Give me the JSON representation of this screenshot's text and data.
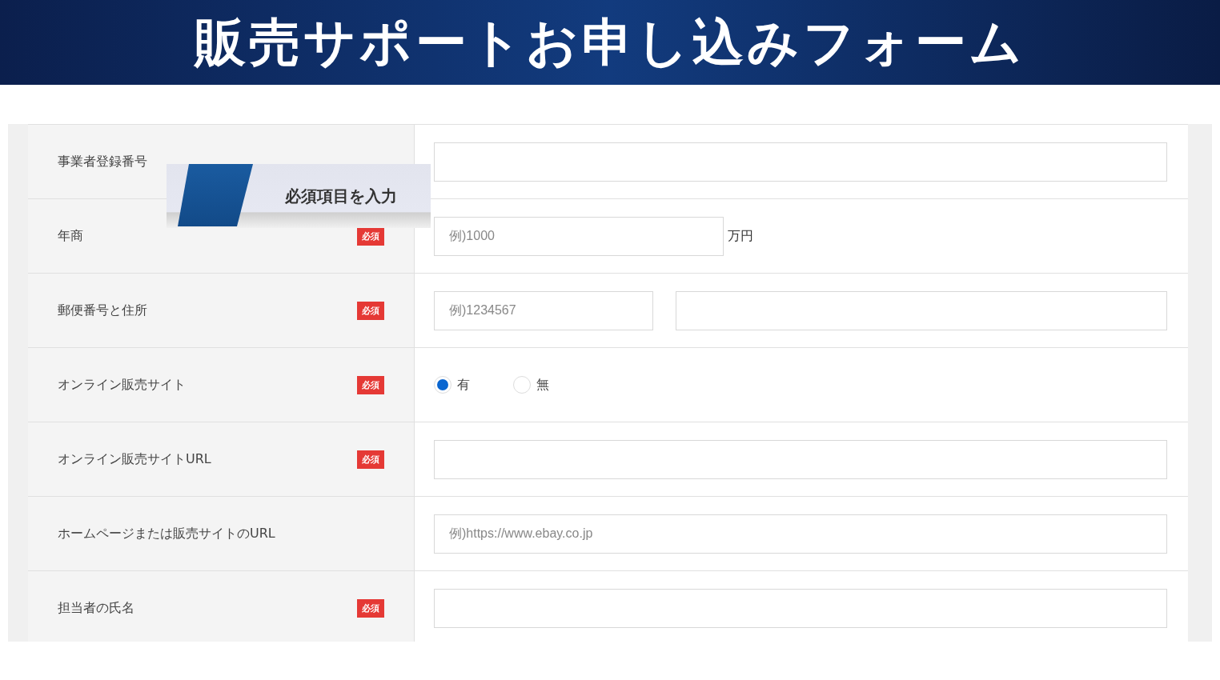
{
  "header": {
    "title": "販売サポートお申し込みフォーム"
  },
  "callout": {
    "text": "必須項目を入力"
  },
  "rows": [
    {
      "label": "事業者登録番号",
      "required": false,
      "kind": "text"
    },
    {
      "label": "年商",
      "required": true,
      "badge": "必須",
      "kind": "unit",
      "placeholder": "例)1000",
      "unit": "万円"
    },
    {
      "label": "郵便番号と住所",
      "required": true,
      "badge": "必須",
      "kind": "postal",
      "placeholder": "例)1234567"
    },
    {
      "label": "オンライン販売サイト",
      "required": true,
      "badge": "必須",
      "kind": "radio",
      "options": [
        {
          "label": "有",
          "selected": true
        },
        {
          "label": "無",
          "selected": false
        }
      ]
    },
    {
      "label": "オンライン販売サイトURL",
      "required": true,
      "badge": "必須",
      "kind": "text"
    },
    {
      "label": "ホームページまたは販売サイトのURL",
      "required": false,
      "kind": "text",
      "placeholder": "例)https://www.ebay.co.jp"
    },
    {
      "label": "担当者の氏名",
      "required": true,
      "badge": "必須",
      "kind": "text"
    }
  ]
}
